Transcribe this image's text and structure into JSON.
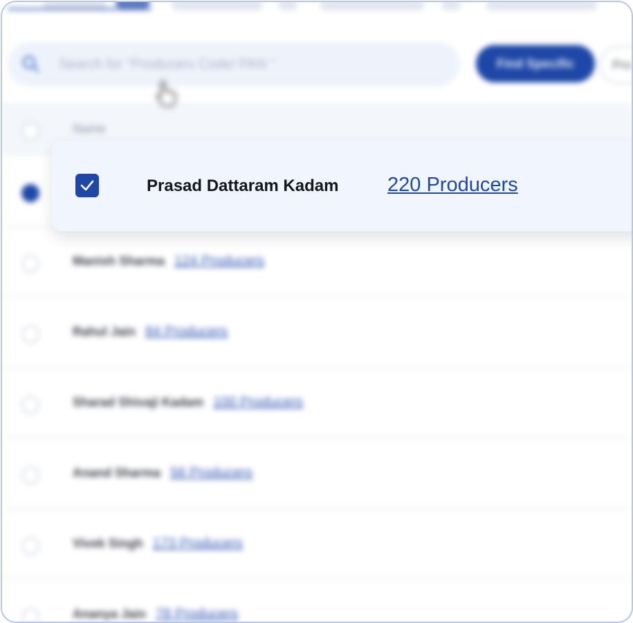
{
  "search": {
    "placeholder": "Search for \"Producers Code/ PAN \"",
    "primary_button": "Find Specific",
    "secondary_button": "Pro"
  },
  "list": {
    "header_label": "Name"
  },
  "selected": {
    "name": "Prasad Dattaram Kadam",
    "producers_link": "220 Producers",
    "checked": true
  },
  "rows": [
    {
      "name": "Manish Sharma",
      "producers": "124 Producers"
    },
    {
      "name": "Rahul Jain",
      "producers": "84 Producers"
    },
    {
      "name": "Sharad Shivaji Kadam",
      "producers": "100 Producers"
    },
    {
      "name": "Anand Sharma",
      "producers": "56 Producers"
    },
    {
      "name": "Vivek Singh",
      "producers": "173 Producers"
    },
    {
      "name": "Ananya Jain",
      "producers": "78 Producers"
    }
  ],
  "colors": {
    "accent": "#1e47a7",
    "link": "#1e47a7",
    "card_bg": "#f1f5fd"
  }
}
